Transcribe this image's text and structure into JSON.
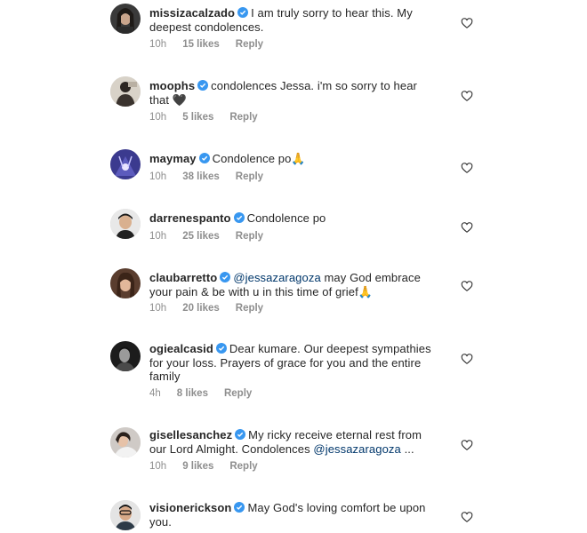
{
  "colors": {
    "text": "#262626",
    "muted": "#8e8e8e",
    "verified": "#3897f0",
    "mention": "#00376b"
  },
  "icons": {
    "verified": "verified-badge-icon",
    "like": "heart-outline-icon",
    "emoji_pray": "🙏",
    "emoji_heart": "🖤"
  },
  "comments": [
    {
      "username": "missizacalzado",
      "line1": "I am truly sorry to hear this. My",
      "line2": "deepest condolences.",
      "time": "10h",
      "likes": "15 likes",
      "reply": "Reply"
    },
    {
      "username": "moophs",
      "line1": "condolences Jessa. i'm so sorry to hear",
      "line2": "that",
      "emoji": "🖤",
      "time": "10h",
      "likes": "5 likes",
      "reply": "Reply"
    },
    {
      "username": "maymay",
      "line1": "Condolence po",
      "emoji": "🙏",
      "time": "10h",
      "likes": "38 likes",
      "reply": "Reply"
    },
    {
      "username": "darrenespanto",
      "line1": "Condolence po",
      "time": "10h",
      "likes": "25 likes",
      "reply": "Reply"
    },
    {
      "username": "claubarretto",
      "mention": "@jessazaragoza",
      "line1": "may God embrace",
      "line2": "your pain & be with u in this time of grief",
      "emoji": "🙏",
      "time": "10h",
      "likes": "20 likes",
      "reply": "Reply"
    },
    {
      "username": "ogiealcasid",
      "line1": "Dear kumare. Our deepest sympathies",
      "line2": "for your loss. Prayers of grace for you and the entire",
      "line3": "family",
      "time": "4h",
      "likes": "8 likes",
      "reply": "Reply"
    },
    {
      "username": "gisellesanchez",
      "line1": "My ricky receive eternal rest from",
      "line2": "our Lord Almight. Condolences",
      "mention": "@jessazaragoza",
      "trail": "...",
      "time": "10h",
      "likes": "9 likes",
      "reply": "Reply"
    },
    {
      "username": "visionerickson",
      "line1": "May God's loving comfort be upon",
      "line2": "you."
    }
  ]
}
